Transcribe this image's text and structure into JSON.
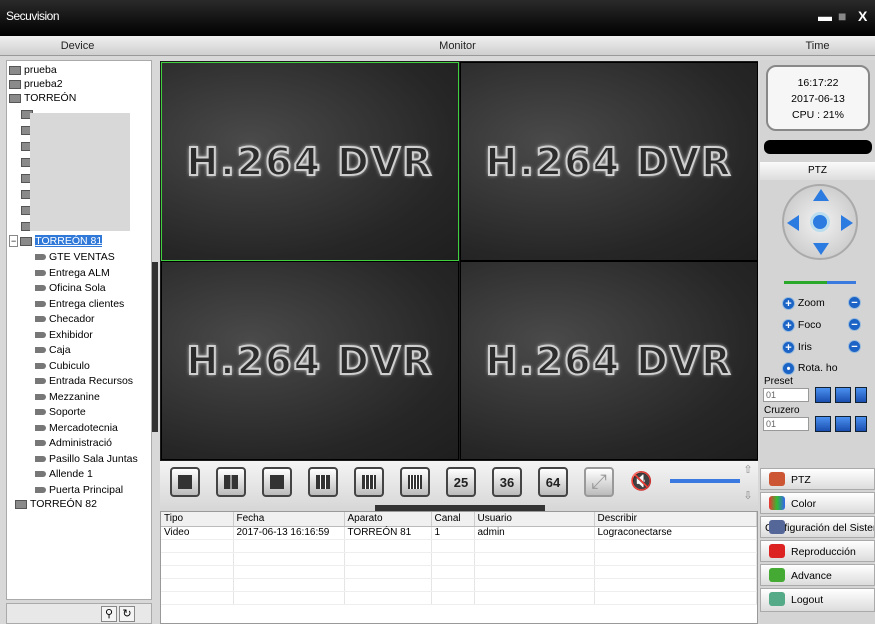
{
  "app": {
    "title": "Secuvision"
  },
  "headers": {
    "device": "Device",
    "monitor": "Monitor",
    "time": "Time"
  },
  "tree": {
    "top": [
      "prueba",
      "prueba2",
      "TORREÓN"
    ],
    "selected_group": "TORREÓN 81",
    "cameras": [
      "GTE VENTAS",
      "Entrega ALM",
      "Oficina Sola",
      "Entrega clientes",
      "Checador",
      "Exhibidor",
      "Caja",
      "Cubiculo",
      "Entrada Recursos",
      "Mezzanine",
      "Soporte",
      "Mercadotecnia",
      "Administració",
      "Pasillo Sala Juntas",
      "Allende 1",
      "Puerta Principal"
    ],
    "last": "TORREÓN 82"
  },
  "monitor": {
    "cells": [
      "H.264 DVR",
      "H.264 DVR",
      "H.264 DVR",
      "H.264 DVR"
    ]
  },
  "layout_buttons": [
    "25",
    "36",
    "64"
  ],
  "log": {
    "columns": [
      "Tipo",
      "Fecha",
      "Aparato",
      "Canal",
      "Usuario",
      "Describir"
    ],
    "rows": [
      [
        "Video",
        "2017-06-13 16:16:59",
        "TORREÓN 81",
        "1",
        "admin",
        "Lograconectarse"
      ]
    ]
  },
  "clock": {
    "time": "16:17:22",
    "date": "2017-06-13",
    "cpu": "CPU : 21%"
  },
  "ptz": {
    "header": "PTZ",
    "zoom": "Zoom",
    "focus": "Foco",
    "iris": "Iris",
    "rotate": "Rota. ho",
    "preset_label": "Preset",
    "preset_value": "01",
    "cruise_label": "Cruzero",
    "cruise_value": "01"
  },
  "nav": [
    "PTZ",
    "Color",
    "Configuración del Sistema",
    "Reproducción",
    "Advance",
    "Logout"
  ]
}
